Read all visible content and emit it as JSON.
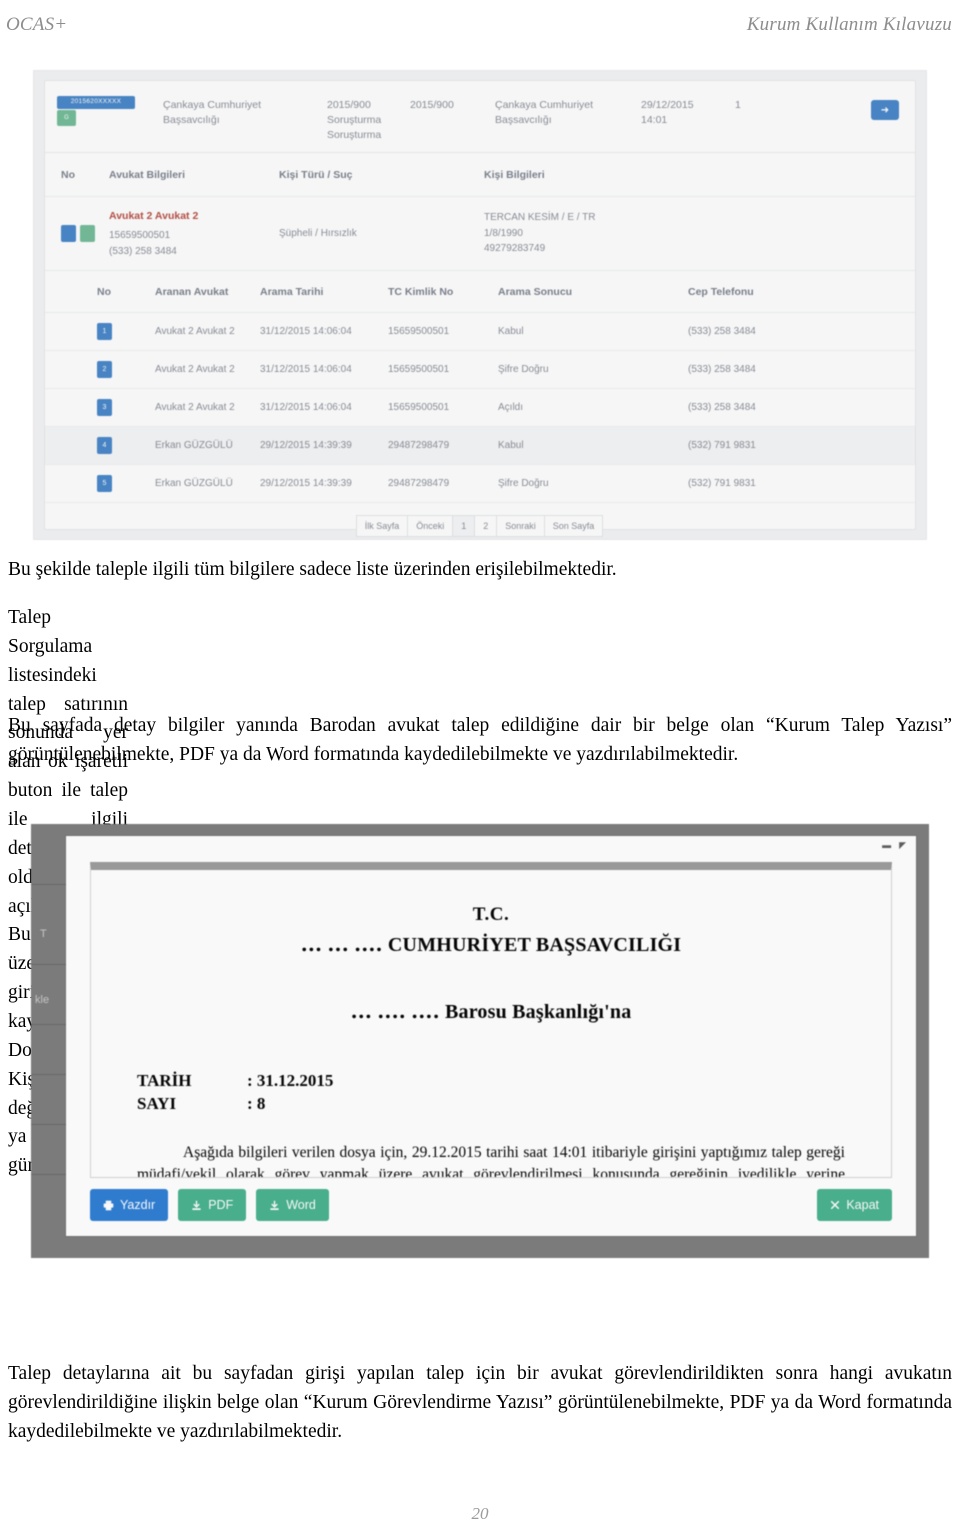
{
  "header": {
    "left": "OCAS+",
    "right": "Kurum Kullanım Kılavuzu"
  },
  "figure_list": {
    "summary_row": {
      "dosya_badge": "2015620XXXXX",
      "status_badge": "G",
      "birim": "Çankaya Cumhuriyet Başsavcılığı",
      "dosya_turu": "2015/900 Soruşturma Soruşturma",
      "dosya_no": "2015/900",
      "talep_eden": "Çankaya Cumhuriyet Başsavcılığı",
      "tarih": "29/12/2015 14:01",
      "adet": "1",
      "detay_icon": "➜"
    },
    "avukat_table": {
      "headers": [
        "No",
        "Avukat Bilgileri",
        "Kişi Türü / Suç",
        "Kişi Bilgileri"
      ],
      "row": {
        "avukat_adi": "Avukat 2 Avukat 2",
        "tc": "15659500501",
        "telefon": "(533) 258 3484",
        "kisi_turu": "Şüpheli / Hırsızlık",
        "kisi_adi": "TERCAN KESİM / E / TR",
        "dogum": "1/8/1990",
        "kisi_tc": "49279283749"
      }
    },
    "arama_table": {
      "headers": [
        "No",
        "Aranan Avukat",
        "Arama Tarihi",
        "TC Kimlik No",
        "Arama Sonucu",
        "Cep Telefonu"
      ],
      "rows": [
        {
          "no": "1",
          "avukat": "Avukat 2 Avukat 2",
          "tarih": "31/12/2015 14:06:04",
          "tc": "15659500501",
          "sonuc": "Kabul",
          "telefon": "(533) 258 3484"
        },
        {
          "no": "2",
          "avukat": "Avukat 2 Avukat 2",
          "tarih": "31/12/2015 14:06:04",
          "tc": "15659500501",
          "sonuc": "Şifre Doğru",
          "telefon": "(533) 258 3484"
        },
        {
          "no": "3",
          "avukat": "Avukat 2 Avukat 2",
          "tarih": "31/12/2015 14:06:04",
          "tc": "15659500501",
          "sonuc": "Açıldı",
          "telefon": "(533) 258 3484"
        },
        {
          "no": "4",
          "avukat": "Erkan GÜZGÜLÜ",
          "tarih": "29/12/2015 14:39:39",
          "tc": "29487298479",
          "sonuc": "Kabul",
          "telefon": "(532) 791 9831"
        },
        {
          "no": "5",
          "avukat": "Erkan GÜZGÜLÜ",
          "tarih": "29/12/2015 14:39:39",
          "tc": "29487298479",
          "sonuc": "Şifre Doğru",
          "telefon": "(532) 791 9831"
        }
      ],
      "pagination": [
        "İlk Sayfa",
        "Önceki",
        "1",
        "2",
        "Sonraki",
        "Son Sayfa"
      ],
      "active_page": "1"
    }
  },
  "prose": {
    "p1": "Bu şekilde taleple ilgili tüm bilgilere sadece liste üzerinden erişilebilmektedir.",
    "p2": "Talep Sorgulama listesindeki talep satırının sonunda yer alan ok işaretli buton ile talep ile  ilgili detayların olduğu sayfa açılmaktadır. Bu detaylar üzerinde talep girişi sırasında kaydedilen Dosya No ve Kişi Bilgileri değiştirilebilmekte ya da güncellenebilmektedir.",
    "p3": "Bu sayfada detay bilgiler yanında Barodan avukat talep edildiğine dair bir belge olan “Kurum Talep Yazısı” görüntülenebilmekte, PDF ya da Word formatında kaydedilebilmekte ve yazdırılabilmektedir.",
    "p4": "Talep detaylarına ait bu sayfadan girişi yapılan talep için bir avukat görevlendirildikten sonra hangi avukatın görevlendirildiğine ilişkin belge olan “Kurum Görevlendirme Yazısı” görüntülenebilmekte, PDF ya da Word formatında kaydedilebilmekte ve yazdırılabilmektedir."
  },
  "figure_doc": {
    "background_labels": {
      "a": "T",
      "b": "kle"
    },
    "letter": {
      "tc": "T.C.",
      "savcilik": "․․․ ․․․ ․․․․ CUMHURİYET BAŞSAVCILIĞI",
      "baro": "․․․ ․․․․ ․․․․ Barosu Başkanlığı'na",
      "tarih_label": "TARİH",
      "tarih_value": ": 31.12.2015",
      "sayi_label": "SAYI",
      "sayi_value": ": 8",
      "body": "Aşağıda bilgileri verilen dosya için, 29.12.2015 tarihi saat 14:01 itibariyle girişini yaptığımız talep gereği müdafi/vekil olarak görev yapmak üzere avukat görevlendirilmesi konusunda gereğinin ivedilikle yerine getirilmesi rica olunur."
    },
    "buttons": {
      "print": "Yazdır",
      "pdf": "PDF",
      "word": "Word",
      "close": "Kapat"
    },
    "colors": {
      "print": "#2b7cd3",
      "green": "#45b08c"
    }
  },
  "footer": {
    "page_number": "20"
  }
}
